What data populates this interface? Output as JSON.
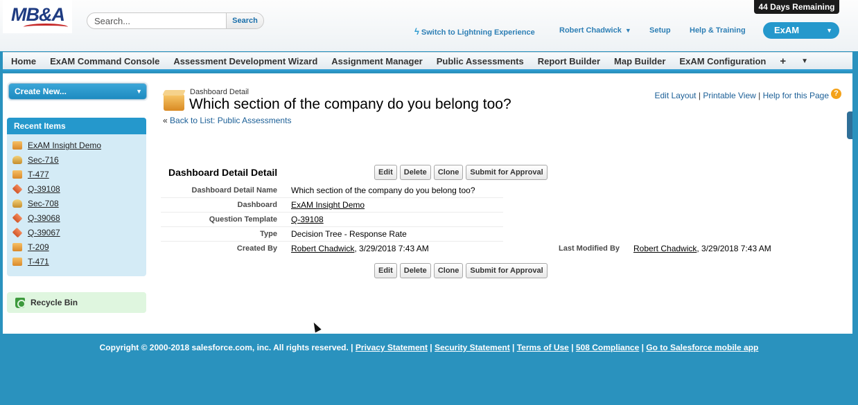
{
  "header": {
    "logo_text": "MB&A",
    "search_placeholder": "Search...",
    "search_button": "Search",
    "trial_badge": "44 Days Remaining",
    "lightning_link": "Switch to Lightning Experience",
    "user_name": "Robert Chadwick",
    "setup_link": "Setup",
    "help_link": "Help & Training",
    "app_name": "ExAM"
  },
  "tabs": [
    "Home",
    "ExAM Command Console",
    "Assessment Development Wizard",
    "Assignment Manager",
    "Public Assessments",
    "Report Builder",
    "Map Builder",
    "ExAM Configuration"
  ],
  "tab_icons": {
    "plus": "+",
    "more": "▼"
  },
  "sidebar": {
    "create_new": "Create New...",
    "recent_title": "Recent Items",
    "recent_items": [
      {
        "label": "ExAM Insight Demo",
        "icon": "box-icon"
      },
      {
        "label": "Sec-716",
        "icon": "stack-icon"
      },
      {
        "label": "T-477",
        "icon": "box-icon"
      },
      {
        "label": "Q-39108",
        "icon": "cube-icon"
      },
      {
        "label": "Sec-708",
        "icon": "stack-icon"
      },
      {
        "label": "Q-39068",
        "icon": "cube-icon"
      },
      {
        "label": "Q-39067",
        "icon": "cube-icon"
      },
      {
        "label": "T-209",
        "icon": "box-icon"
      },
      {
        "label": "T-471",
        "icon": "box-icon"
      }
    ],
    "recycle_bin": "Recycle Bin"
  },
  "page": {
    "type": "Dashboard Detail",
    "title": "Which section of the company do you belong too?",
    "back_prefix": "«",
    "back_link": "Back to List: Public Assessments",
    "edit_layout": "Edit Layout",
    "printable_view": "Printable View",
    "help_page": "Help for this Page",
    "help_icon": "?"
  },
  "detail": {
    "section_title": "Dashboard Detail Detail",
    "buttons": [
      "Edit",
      "Delete",
      "Clone",
      "Submit for Approval"
    ],
    "fields": [
      {
        "label": "Dashboard Detail Name",
        "value": "Which section of the company do you belong too?",
        "link": false
      },
      {
        "label": "Dashboard",
        "value": "ExAM Insight Demo",
        "link": true
      },
      {
        "label": "Question Template",
        "value": "Q-39108",
        "link": true
      },
      {
        "label": "Type",
        "value": "Decision Tree - Response Rate",
        "link": false
      }
    ],
    "created_by_label": "Created By",
    "created_by_name": "Robert Chadwick",
    "created_by_date": ", 3/29/2018 7:43 AM",
    "last_modified_label": "Last Modified By",
    "last_modified_name": "Robert Chadwick",
    "last_modified_date": ", 3/29/2018 7:43 AM"
  },
  "footer": {
    "copyright": "Copyright © 2000-2018 salesforce.com, inc. All rights reserved. |",
    "links": [
      "Privacy Statement",
      "Security Statement",
      "Terms of Use",
      "508 Compliance",
      "Go to Salesforce mobile app"
    ]
  },
  "colors": {
    "brand_blue": "#2598cc",
    "footer_bg": "#2a92be",
    "link_blue": "#1a5e96"
  }
}
